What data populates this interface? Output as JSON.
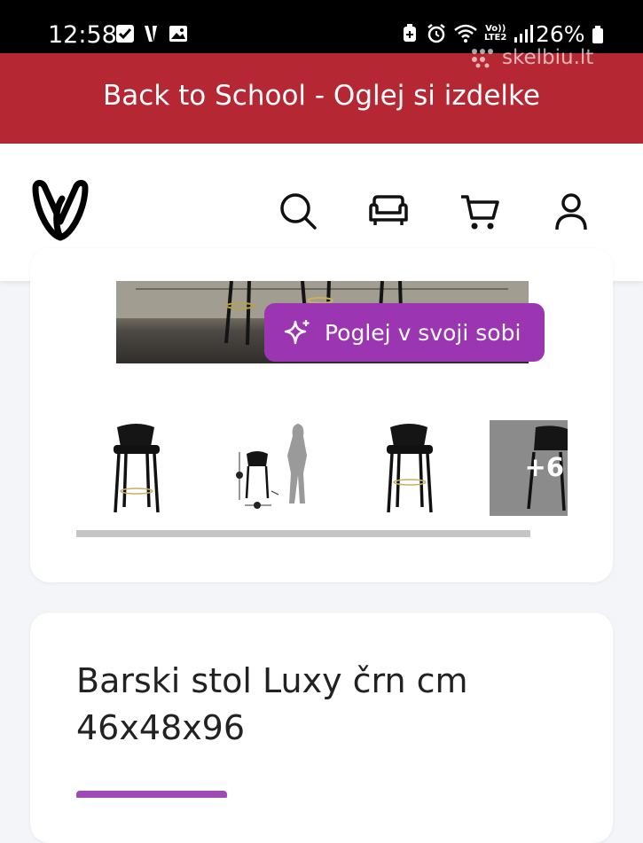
{
  "status_bar": {
    "time": "12:58",
    "battery": "26%",
    "network": "LTE2",
    "network_top": "Vo))"
  },
  "watermark": {
    "text": "skelbiu.lt"
  },
  "banner": {
    "text": "Back to School - Oglej si izdelke"
  },
  "header": {
    "logo": "brand-logo",
    "icons": [
      "search-icon",
      "sofa-icon",
      "cart-icon",
      "account-icon"
    ]
  },
  "gallery": {
    "ar_button_label": "Poglej v svoji sobi",
    "more_count": "+6"
  },
  "product": {
    "title": "Barski stol Luxy črn cm 46x48x96"
  },
  "colors": {
    "banner": "#b52732",
    "accent": "#9b35b2",
    "background": "#f4f5f8"
  }
}
